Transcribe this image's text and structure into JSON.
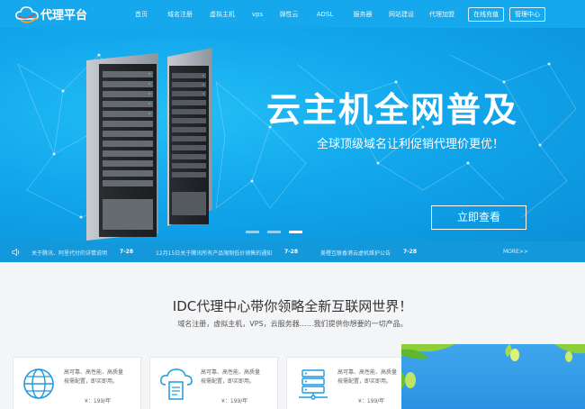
{
  "header": {
    "logo_text": "代理平台",
    "nav": [
      "首页",
      "域名注册",
      "虚拟主机",
      "vps",
      "弹性云",
      "ADSL",
      "服务器",
      "网站建设",
      "代理加盟"
    ],
    "btn_consult": "在线充值",
    "btn_admin": "管理中心"
  },
  "banner": {
    "headline": "云主机全网普及",
    "subline": "全球顶级域名让利促销代理价更优！",
    "cta": "立即查看",
    "slides": 3,
    "active_slide": 3
  },
  "news": {
    "items": [
      {
        "title": "关于腾讯、阿里代付的详情说明",
        "date": "7-28"
      },
      {
        "title": "12月15日关于腾讯所有产品限制低价销售的通知",
        "date": "7-28"
      },
      {
        "title": "美橙互联香港云虚机维护公告",
        "date": "7-28"
      }
    ],
    "more": "MORE>>"
  },
  "intro": {
    "title": "IDC代理中心带你领略全新互联网世界！",
    "subtitle": "域名注册，虚拟主机，VPS，云服务器……我们提供你想要的一切产品。"
  },
  "cards": [
    {
      "icon": "globe-icon",
      "line1": "高可靠、高性能、高质量",
      "line2": "按需配置，即买即用。",
      "price": "¥：199/年"
    },
    {
      "icon": "cloud-doc-icon",
      "line1": "高可靠、高性能、高质量",
      "line2": "按需配置，即买即用。",
      "price": "¥：199/年"
    },
    {
      "icon": "server-network-icon",
      "line1": "高可靠、高性能、高质量",
      "line2": "按需配置，即买即用。",
      "price": "¥：199/年"
    }
  ],
  "colors": {
    "primary": "#16a8ec",
    "news_bar": "#1398dc",
    "page_bg": "#f4f5f7"
  }
}
